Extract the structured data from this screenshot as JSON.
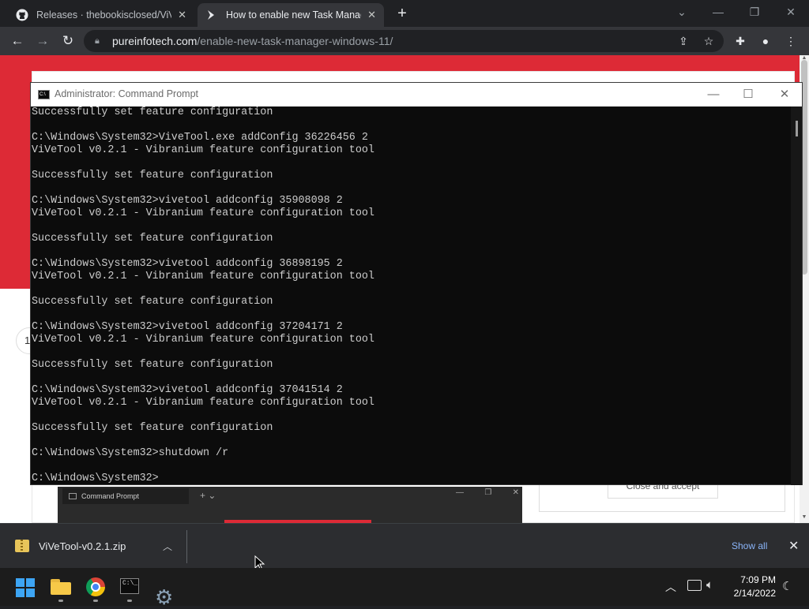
{
  "browser": {
    "tabs": [
      {
        "title": "Releases · thebookisclosed/ViVe",
        "icon": "github-icon"
      },
      {
        "title": "How to enable new Task Manager",
        "icon": "pureinfotech-icon",
        "active": true
      }
    ],
    "new_tab": "+",
    "url_host": "pureinfotech.com",
    "url_path": "/enable-new-task-manager-windows-11/",
    "colors": {
      "tabstrip": "#202124",
      "toolbar": "#35363a",
      "page_red": "#dd2a36"
    }
  },
  "page": {
    "number_badge": "1",
    "consent_button": "Close and accept",
    "embedded_tab_title": "Command Prompt"
  },
  "cmd": {
    "title": "Administrator: Command Prompt",
    "lines": [
      "Successfully set feature configuration",
      "",
      "C:\\Windows\\System32>ViveTool.exe addConfig 36226456 2",
      "ViVeTool v0.2.1 - Vibranium feature configuration tool",
      "",
      "Successfully set feature configuration",
      "",
      "C:\\Windows\\System32>vivetool addconfig 35908098 2",
      "ViVeTool v0.2.1 - Vibranium feature configuration tool",
      "",
      "Successfully set feature configuration",
      "",
      "C:\\Windows\\System32>vivetool addconfig 36898195 2",
      "ViVeTool v0.2.1 - Vibranium feature configuration tool",
      "",
      "Successfully set feature configuration",
      "",
      "C:\\Windows\\System32>vivetool addconfig 37204171 2",
      "ViVeTool v0.2.1 - Vibranium feature configuration tool",
      "",
      "Successfully set feature configuration",
      "",
      "C:\\Windows\\System32>vivetool addconfig 37041514 2",
      "ViVeTool v0.2.1 - Vibranium feature configuration tool",
      "",
      "Successfully set feature configuration",
      "",
      "C:\\Windows\\System32>shutdown /r",
      "",
      "C:\\Windows\\System32>"
    ]
  },
  "downloads": {
    "file_name": "ViVeTool-v0.2.1.zip",
    "show_all": "Show all"
  },
  "taskbar": {
    "time": "7:09 PM",
    "date": "2/14/2022"
  }
}
